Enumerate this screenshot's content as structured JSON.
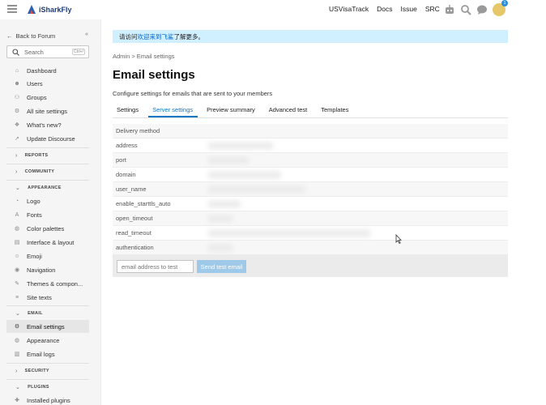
{
  "header": {
    "logo_text": "iSharkFly",
    "links": [
      "USVisaTrack",
      "Docs",
      "Issue",
      "SRC"
    ],
    "notification_count": "1"
  },
  "sidebar": {
    "back_label": "Back to Forum",
    "search_placeholder": "Search",
    "search_shortcut": "Ctrl+/",
    "top_items": [
      {
        "label": "Dashboard",
        "icon": "home-icon"
      },
      {
        "label": "Users",
        "icon": "users-icon"
      },
      {
        "label": "Groups",
        "icon": "groups-icon"
      },
      {
        "label": "All site settings",
        "icon": "gear-icon"
      },
      {
        "label": "What's new?",
        "icon": "gift-icon"
      },
      {
        "label": "Update Discourse",
        "icon": "rocket-icon"
      }
    ],
    "sections": {
      "reports": "REPORTS",
      "community": "COMMUNITY",
      "appearance": "APPEARANCE",
      "email": "EMAIL",
      "security": "SECURITY",
      "plugins": "PLUGINS"
    },
    "appearance_items": [
      {
        "label": "Logo",
        "icon": "logo-icon"
      },
      {
        "label": "Fonts",
        "icon": "font-icon"
      },
      {
        "label": "Color palettes",
        "icon": "palette-icon"
      },
      {
        "label": "Interface & layout",
        "icon": "layout-icon"
      },
      {
        "label": "Emoji",
        "icon": "emoji-icon"
      },
      {
        "label": "Navigation",
        "icon": "compass-icon"
      },
      {
        "label": "Themes & compon...",
        "icon": "brush-icon"
      },
      {
        "label": "Site texts",
        "icon": "texts-icon"
      }
    ],
    "email_items": [
      {
        "label": "Email settings",
        "icon": "gear-icon",
        "active": true
      },
      {
        "label": "Appearance",
        "icon": "palette-icon"
      },
      {
        "label": "Email logs",
        "icon": "logs-icon"
      }
    ],
    "plugin_items": [
      {
        "label": "Installed plugins",
        "icon": "puzzle-icon"
      }
    ]
  },
  "main": {
    "banner_prefix": "请访问 ",
    "banner_link": "欢迎来到飞鲨",
    "banner_suffix": " 了解更多。",
    "breadcrumb": "Admin > Email settings",
    "title": "Email settings",
    "subtitle": "Configure settings for emails that are sent to your members",
    "tabs": [
      "Settings",
      "Server settings",
      "Preview summary",
      "Advanced test",
      "Templates"
    ],
    "active_tab": 1,
    "rows": [
      "Delivery method",
      "address",
      "port",
      "domain",
      "user_name",
      "enable_starttls_auto",
      "open_timeout",
      "read_timeout",
      "authentication"
    ],
    "test_placeholder": "email address to test",
    "test_button": "Send test email"
  },
  "colors": {
    "accent": "#0b77c5",
    "banner_bg": "#d1f0ff",
    "sidebar_bg": "#f5f5f5",
    "button_disabled": "#9ec9e8"
  }
}
